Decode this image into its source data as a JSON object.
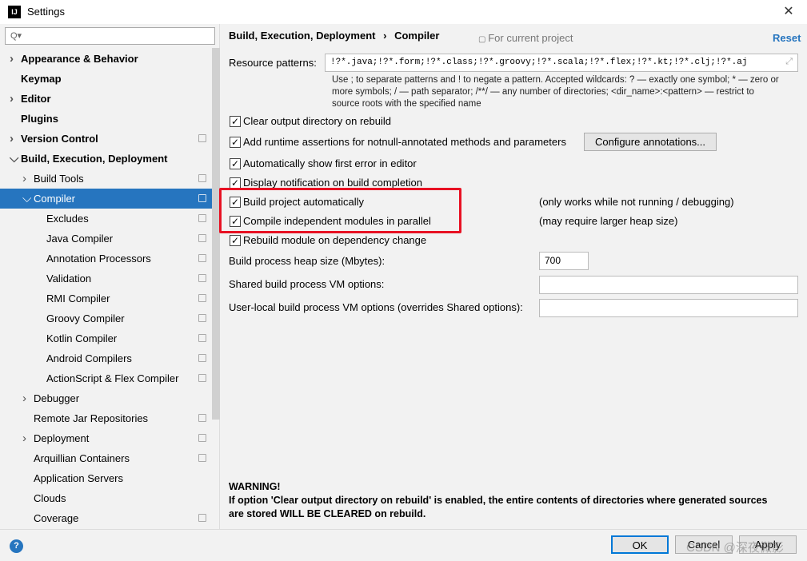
{
  "window": {
    "title": "Settings",
    "icon": "intellij-icon"
  },
  "search": {
    "placeholder": "Q▾"
  },
  "sidebar": {
    "items": [
      {
        "label": "Appearance & Behavior",
        "bold": true,
        "arrow": "right",
        "indent": 0
      },
      {
        "label": "Keymap",
        "bold": true,
        "indent": 0
      },
      {
        "label": "Editor",
        "bold": true,
        "arrow": "right",
        "indent": 0
      },
      {
        "label": "Plugins",
        "bold": true,
        "indent": 0
      },
      {
        "label": "Version Control",
        "bold": true,
        "arrow": "right",
        "indent": 0,
        "proj": true
      },
      {
        "label": "Build, Execution, Deployment",
        "bold": true,
        "arrow": "down",
        "indent": 0
      },
      {
        "label": "Build Tools",
        "arrow": "right",
        "indent": 1,
        "proj": true
      },
      {
        "label": "Compiler",
        "arrow": "down",
        "indent": 1,
        "proj": true,
        "selected": true
      },
      {
        "label": "Excludes",
        "indent": 2,
        "proj": true
      },
      {
        "label": "Java Compiler",
        "indent": 2,
        "proj": true
      },
      {
        "label": "Annotation Processors",
        "indent": 2,
        "proj": true
      },
      {
        "label": "Validation",
        "indent": 2,
        "proj": true
      },
      {
        "label": "RMI Compiler",
        "indent": 2,
        "proj": true
      },
      {
        "label": "Groovy Compiler",
        "indent": 2,
        "proj": true
      },
      {
        "label": "Kotlin Compiler",
        "indent": 2,
        "proj": true
      },
      {
        "label": "Android Compilers",
        "indent": 2,
        "proj": true
      },
      {
        "label": "ActionScript & Flex Compiler",
        "indent": 2,
        "proj": true
      },
      {
        "label": "Debugger",
        "arrow": "right",
        "indent": 1
      },
      {
        "label": "Remote Jar Repositories",
        "indent": 1,
        "proj": true
      },
      {
        "label": "Deployment",
        "arrow": "right",
        "indent": 1,
        "proj": true
      },
      {
        "label": "Arquillian Containers",
        "indent": 1,
        "proj": true
      },
      {
        "label": "Application Servers",
        "indent": 1
      },
      {
        "label": "Clouds",
        "indent": 1
      },
      {
        "label": "Coverage",
        "indent": 1,
        "proj": true
      }
    ]
  },
  "header": {
    "breadcrumb_parent": "Build, Execution, Deployment",
    "breadcrumb_sep": "›",
    "breadcrumb_current": "Compiler",
    "scope": "For current project",
    "reset": "Reset"
  },
  "resource": {
    "label": "Resource patterns:",
    "value": "!?*.java;!?*.form;!?*.class;!?*.groovy;!?*.scala;!?*.flex;!?*.kt;!?*.clj;!?*.aj",
    "help1": "Use ; to separate patterns and ! to negate a pattern. Accepted wildcards: ? — exactly one symbol; * — zero or",
    "help2": "more symbols; / — path separator; /**/ — any number of directories; <dir_name>:<pattern> — restrict to",
    "help3": "source roots with the specified name"
  },
  "options": [
    {
      "label": "Clear output directory on rebuild",
      "checked": true
    },
    {
      "label": "Add runtime assertions for notnull-annotated methods and parameters",
      "checked": true
    },
    {
      "label": "Automatically show first error in editor",
      "checked": true
    },
    {
      "label": "Display notification on build completion",
      "checked": true
    },
    {
      "label": "Build project automatically",
      "checked": true,
      "note": "(only works while not running / debugging)"
    },
    {
      "label": "Compile independent modules in parallel",
      "checked": true,
      "note": "(may require larger heap size)"
    },
    {
      "label": "Rebuild module on dependency change",
      "checked": true
    }
  ],
  "configure_button": "Configure annotations...",
  "heap": {
    "label": "Build process heap size (Mbytes):",
    "value": "700"
  },
  "shared_vm": {
    "label": "Shared build process VM options:",
    "value": ""
  },
  "local_vm": {
    "label": "User-local build process VM options (overrides Shared options):",
    "value": ""
  },
  "warning": {
    "title": "WARNING!",
    "line1": "If option 'Clear output directory on rebuild' is enabled, the entire contents of directories where generated sources",
    "line2": "are stored WILL BE CLEARED on rebuild."
  },
  "footer": {
    "help": "?",
    "ok": "OK",
    "cancel": "Cancel",
    "apply": "Apply",
    "watermark": "CSDN @深夜微影"
  },
  "colors": {
    "selection": "#2675bf",
    "highlight_box": "#e81123",
    "link": "#2675bf"
  }
}
